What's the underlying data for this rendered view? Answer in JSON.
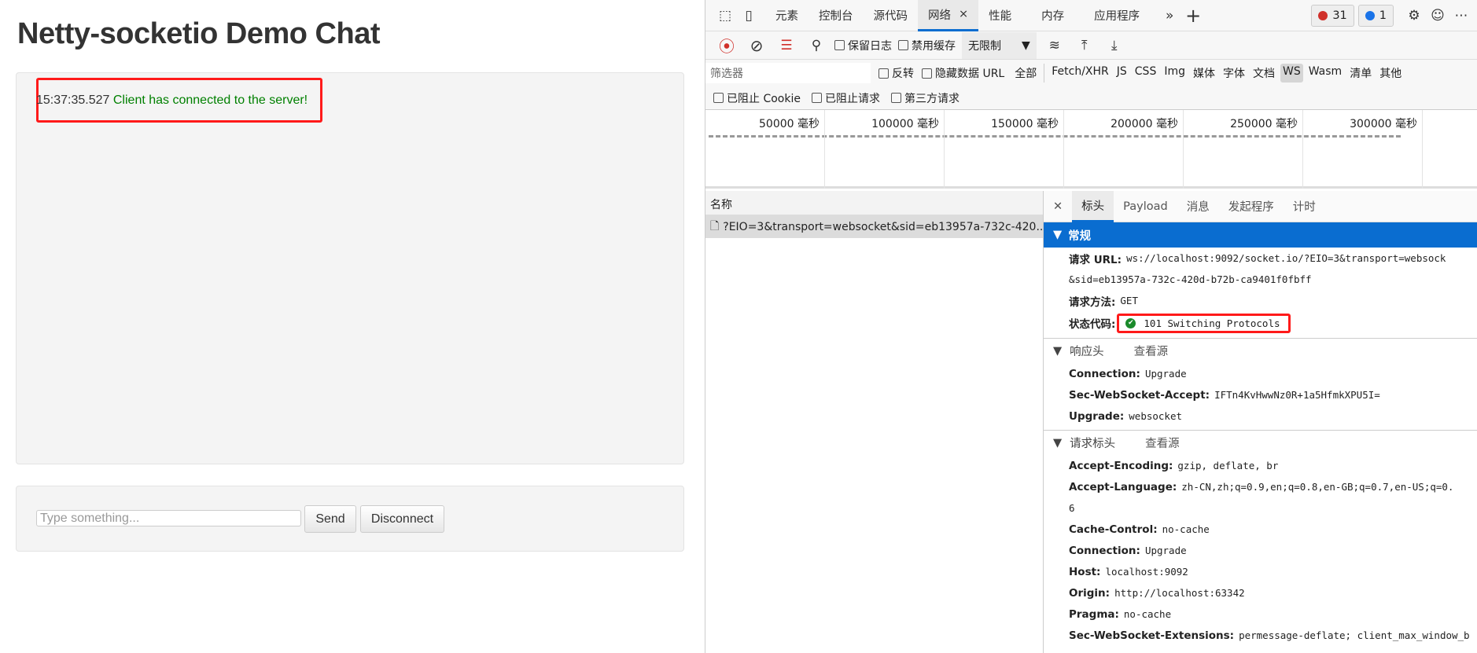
{
  "page": {
    "title": "Netty-socketio Demo Chat",
    "messages": [
      {
        "time": "15:37:35.527",
        "text": "Client has connected to the server!"
      }
    ],
    "input_placeholder": "Type something...",
    "send_label": "Send",
    "disconnect_label": "Disconnect"
  },
  "devtools": {
    "tabs": [
      "元素",
      "控制台",
      "源代码",
      "网络",
      "性能",
      "内存",
      "应用程序"
    ],
    "more_tabs": "»",
    "add_tab": "+",
    "error_count": "31",
    "message_count": "1",
    "more_menu": "⋯",
    "toolbar": {
      "preserve_log": "保留日志",
      "disable_cache": "禁用缓存",
      "throttle": "无限制"
    },
    "filter": {
      "placeholder": "筛选器",
      "invert": "反转",
      "hide_data_url": "隐藏数据 URL",
      "types": [
        "全部",
        "Fetch/XHR",
        "JS",
        "CSS",
        "Img",
        "媒体",
        "字体",
        "文档",
        "WS",
        "Wasm",
        "清单",
        "其他"
      ],
      "selected_type": "WS",
      "blocked_cookies": "已阻止 Cookie",
      "blocked_requests": "已阻止请求",
      "third_party": "第三方请求"
    },
    "timeline_ticks": [
      "50000 毫秒",
      "100000 毫秒",
      "150000 毫秒",
      "200000 毫秒",
      "250000 毫秒",
      "300000 毫秒"
    ],
    "name_header": "名称",
    "requests": [
      "?EIO=3&transport=websocket&sid=eb13957a-732c-420..."
    ],
    "detail_tabs": [
      "标头",
      "Payload",
      "消息",
      "发起程序",
      "计时"
    ],
    "general": {
      "title": "常规",
      "url_label": "请求 URL:",
      "url_1": "ws://localhost:9092/socket.io/?EIO=3&transport=websock",
      "url_2": "&sid=eb13957a-732c-420d-b72b-ca9401f0fbff",
      "method_label": "请求方法:",
      "method": "GET",
      "status_label": "状态代码:",
      "status": "101 Switching Protocols"
    },
    "response_headers": {
      "title": "响应头",
      "view_source": "查看源",
      "items": [
        {
          "k": "Connection:",
          "v": "Upgrade"
        },
        {
          "k": "Sec-WebSocket-Accept:",
          "v": "IFTn4KvHwwNz0R+1a5HfmkXPU5I="
        },
        {
          "k": "Upgrade:",
          "v": "websocket"
        }
      ]
    },
    "request_headers": {
      "title": "请求标头",
      "view_source": "查看源",
      "items": [
        {
          "k": "Accept-Encoding:",
          "v": "gzip, deflate, br"
        },
        {
          "k": "Accept-Language:",
          "v": "zh-CN,zh;q=0.9,en;q=0.8,en-GB;q=0.7,en-US;q=0."
        },
        {
          "k": "",
          "v": "6"
        },
        {
          "k": "Cache-Control:",
          "v": "no-cache"
        },
        {
          "k": "Connection:",
          "v": "Upgrade"
        },
        {
          "k": "Host:",
          "v": "localhost:9092"
        },
        {
          "k": "Origin:",
          "v": "http://localhost:63342"
        },
        {
          "k": "Pragma:",
          "v": "no-cache"
        },
        {
          "k": "Sec-WebSocket-Extensions:",
          "v": "permessage-deflate; client_max_window_b"
        }
      ]
    }
  }
}
